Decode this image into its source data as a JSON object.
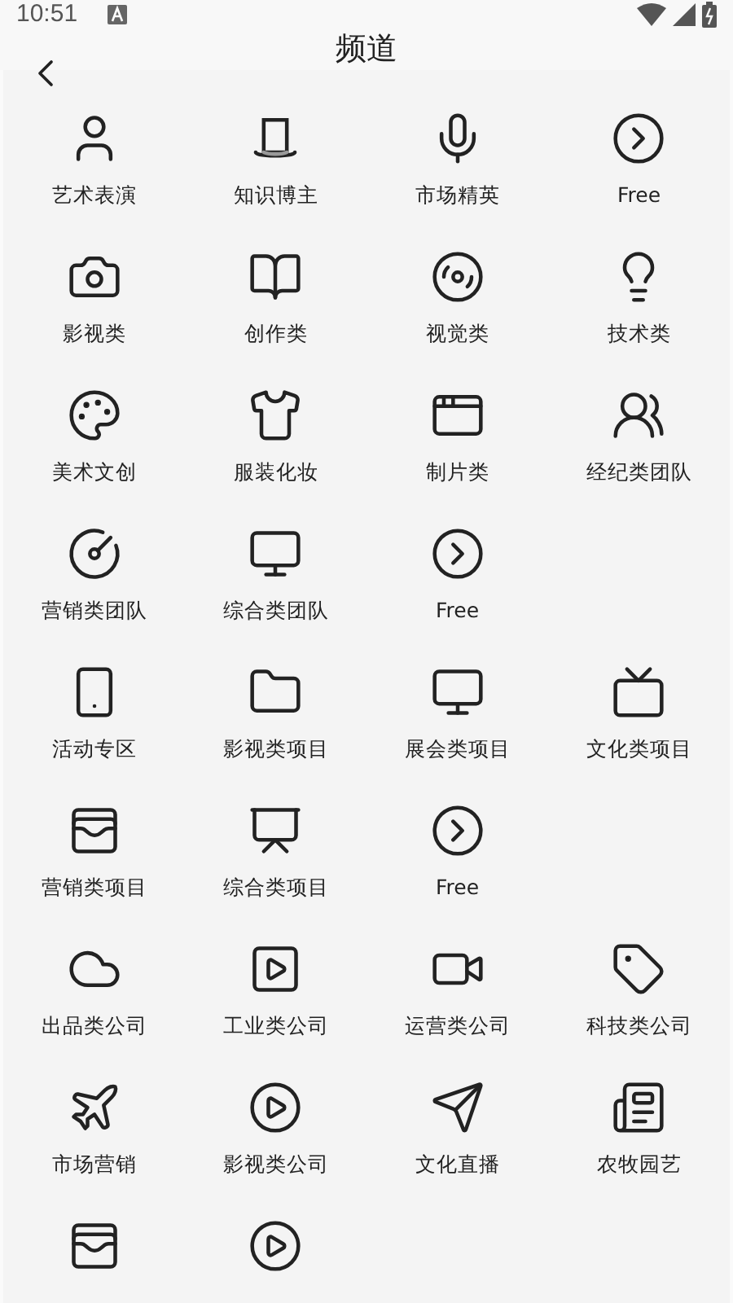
{
  "status_bar": {
    "time": "10:51"
  },
  "header": {
    "title": "频道"
  },
  "channels": [
    {
      "label": "艺术表演",
      "kind": "channel"
    },
    {
      "label": "知识博主",
      "kind": "channel"
    },
    {
      "label": "市场精英",
      "kind": "channel"
    },
    {
      "label": "Free",
      "kind": "channel"
    },
    {
      "label": "影视类",
      "kind": "channel"
    },
    {
      "label": "创作类",
      "kind": "channel"
    },
    {
      "label": "视觉类",
      "kind": "channel"
    },
    {
      "label": "技术类",
      "kind": "channel"
    },
    {
      "label": "美术文创",
      "kind": "channel"
    },
    {
      "label": "服装化妆",
      "kind": "channel"
    },
    {
      "label": "制片类",
      "kind": "channel"
    },
    {
      "label": "经纪类团队",
      "kind": "channel"
    },
    {
      "label": "营销类团队",
      "kind": "channel"
    },
    {
      "label": "综合类团队",
      "kind": "channel"
    },
    {
      "label": "Free",
      "kind": "channel"
    },
    {
      "kind": "blank"
    },
    {
      "label": "活动专区",
      "kind": "channel"
    },
    {
      "label": "影视类项目",
      "kind": "channel"
    },
    {
      "label": "展会类项目",
      "kind": "channel"
    },
    {
      "label": "文化类项目",
      "kind": "channel"
    },
    {
      "label": "营销类项目",
      "kind": "channel"
    },
    {
      "label": "综合类项目",
      "kind": "channel"
    },
    {
      "label": "Free",
      "kind": "channel"
    },
    {
      "kind": "blank"
    },
    {
      "label": "出品类公司",
      "kind": "channel"
    },
    {
      "label": "工业类公司",
      "kind": "channel"
    },
    {
      "label": "运营类公司",
      "kind": "channel"
    },
    {
      "label": "科技类公司",
      "kind": "channel"
    },
    {
      "label": "市场营销",
      "kind": "channel"
    },
    {
      "label": "影视类公司",
      "kind": "channel"
    },
    {
      "label": "文化直播",
      "kind": "channel"
    },
    {
      "label": "农牧园艺",
      "kind": "channel"
    },
    {
      "kind": "cut"
    },
    {
      "kind": "cut"
    }
  ]
}
